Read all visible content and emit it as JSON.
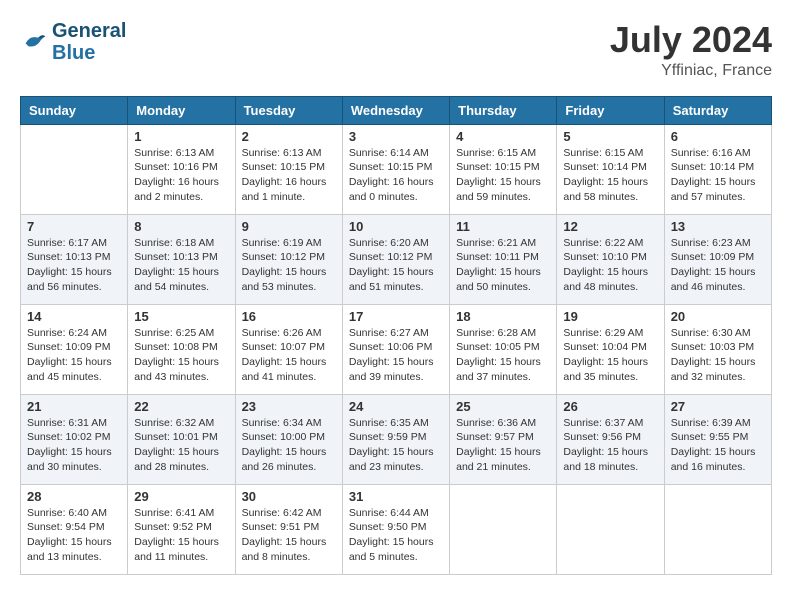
{
  "header": {
    "logo_line1": "General",
    "logo_line2": "Blue",
    "month_year": "July 2024",
    "location": "Yffiniac, France"
  },
  "days_of_week": [
    "Sunday",
    "Monday",
    "Tuesday",
    "Wednesday",
    "Thursday",
    "Friday",
    "Saturday"
  ],
  "weeks": [
    [
      {
        "day": "",
        "sunrise": "",
        "sunset": "",
        "daylight": ""
      },
      {
        "day": "1",
        "sunrise": "Sunrise: 6:13 AM",
        "sunset": "Sunset: 10:16 PM",
        "daylight": "Daylight: 16 hours and 2 minutes."
      },
      {
        "day": "2",
        "sunrise": "Sunrise: 6:13 AM",
        "sunset": "Sunset: 10:15 PM",
        "daylight": "Daylight: 16 hours and 1 minute."
      },
      {
        "day": "3",
        "sunrise": "Sunrise: 6:14 AM",
        "sunset": "Sunset: 10:15 PM",
        "daylight": "Daylight: 16 hours and 0 minutes."
      },
      {
        "day": "4",
        "sunrise": "Sunrise: 6:15 AM",
        "sunset": "Sunset: 10:15 PM",
        "daylight": "Daylight: 15 hours and 59 minutes."
      },
      {
        "day": "5",
        "sunrise": "Sunrise: 6:15 AM",
        "sunset": "Sunset: 10:14 PM",
        "daylight": "Daylight: 15 hours and 58 minutes."
      },
      {
        "day": "6",
        "sunrise": "Sunrise: 6:16 AM",
        "sunset": "Sunset: 10:14 PM",
        "daylight": "Daylight: 15 hours and 57 minutes."
      }
    ],
    [
      {
        "day": "7",
        "sunrise": "Sunrise: 6:17 AM",
        "sunset": "Sunset: 10:13 PM",
        "daylight": "Daylight: 15 hours and 56 minutes."
      },
      {
        "day": "8",
        "sunrise": "Sunrise: 6:18 AM",
        "sunset": "Sunset: 10:13 PM",
        "daylight": "Daylight: 15 hours and 54 minutes."
      },
      {
        "day": "9",
        "sunrise": "Sunrise: 6:19 AM",
        "sunset": "Sunset: 10:12 PM",
        "daylight": "Daylight: 15 hours and 53 minutes."
      },
      {
        "day": "10",
        "sunrise": "Sunrise: 6:20 AM",
        "sunset": "Sunset: 10:12 PM",
        "daylight": "Daylight: 15 hours and 51 minutes."
      },
      {
        "day": "11",
        "sunrise": "Sunrise: 6:21 AM",
        "sunset": "Sunset: 10:11 PM",
        "daylight": "Daylight: 15 hours and 50 minutes."
      },
      {
        "day": "12",
        "sunrise": "Sunrise: 6:22 AM",
        "sunset": "Sunset: 10:10 PM",
        "daylight": "Daylight: 15 hours and 48 minutes."
      },
      {
        "day": "13",
        "sunrise": "Sunrise: 6:23 AM",
        "sunset": "Sunset: 10:09 PM",
        "daylight": "Daylight: 15 hours and 46 minutes."
      }
    ],
    [
      {
        "day": "14",
        "sunrise": "Sunrise: 6:24 AM",
        "sunset": "Sunset: 10:09 PM",
        "daylight": "Daylight: 15 hours and 45 minutes."
      },
      {
        "day": "15",
        "sunrise": "Sunrise: 6:25 AM",
        "sunset": "Sunset: 10:08 PM",
        "daylight": "Daylight: 15 hours and 43 minutes."
      },
      {
        "day": "16",
        "sunrise": "Sunrise: 6:26 AM",
        "sunset": "Sunset: 10:07 PM",
        "daylight": "Daylight: 15 hours and 41 minutes."
      },
      {
        "day": "17",
        "sunrise": "Sunrise: 6:27 AM",
        "sunset": "Sunset: 10:06 PM",
        "daylight": "Daylight: 15 hours and 39 minutes."
      },
      {
        "day": "18",
        "sunrise": "Sunrise: 6:28 AM",
        "sunset": "Sunset: 10:05 PM",
        "daylight": "Daylight: 15 hours and 37 minutes."
      },
      {
        "day": "19",
        "sunrise": "Sunrise: 6:29 AM",
        "sunset": "Sunset: 10:04 PM",
        "daylight": "Daylight: 15 hours and 35 minutes."
      },
      {
        "day": "20",
        "sunrise": "Sunrise: 6:30 AM",
        "sunset": "Sunset: 10:03 PM",
        "daylight": "Daylight: 15 hours and 32 minutes."
      }
    ],
    [
      {
        "day": "21",
        "sunrise": "Sunrise: 6:31 AM",
        "sunset": "Sunset: 10:02 PM",
        "daylight": "Daylight: 15 hours and 30 minutes."
      },
      {
        "day": "22",
        "sunrise": "Sunrise: 6:32 AM",
        "sunset": "Sunset: 10:01 PM",
        "daylight": "Daylight: 15 hours and 28 minutes."
      },
      {
        "day": "23",
        "sunrise": "Sunrise: 6:34 AM",
        "sunset": "Sunset: 10:00 PM",
        "daylight": "Daylight: 15 hours and 26 minutes."
      },
      {
        "day": "24",
        "sunrise": "Sunrise: 6:35 AM",
        "sunset": "Sunset: 9:59 PM",
        "daylight": "Daylight: 15 hours and 23 minutes."
      },
      {
        "day": "25",
        "sunrise": "Sunrise: 6:36 AM",
        "sunset": "Sunset: 9:57 PM",
        "daylight": "Daylight: 15 hours and 21 minutes."
      },
      {
        "day": "26",
        "sunrise": "Sunrise: 6:37 AM",
        "sunset": "Sunset: 9:56 PM",
        "daylight": "Daylight: 15 hours and 18 minutes."
      },
      {
        "day": "27",
        "sunrise": "Sunrise: 6:39 AM",
        "sunset": "Sunset: 9:55 PM",
        "daylight": "Daylight: 15 hours and 16 minutes."
      }
    ],
    [
      {
        "day": "28",
        "sunrise": "Sunrise: 6:40 AM",
        "sunset": "Sunset: 9:54 PM",
        "daylight": "Daylight: 15 hours and 13 minutes."
      },
      {
        "day": "29",
        "sunrise": "Sunrise: 6:41 AM",
        "sunset": "Sunset: 9:52 PM",
        "daylight": "Daylight: 15 hours and 11 minutes."
      },
      {
        "day": "30",
        "sunrise": "Sunrise: 6:42 AM",
        "sunset": "Sunset: 9:51 PM",
        "daylight": "Daylight: 15 hours and 8 minutes."
      },
      {
        "day": "31",
        "sunrise": "Sunrise: 6:44 AM",
        "sunset": "Sunset: 9:50 PM",
        "daylight": "Daylight: 15 hours and 5 minutes."
      },
      {
        "day": "",
        "sunrise": "",
        "sunset": "",
        "daylight": ""
      },
      {
        "day": "",
        "sunrise": "",
        "sunset": "",
        "daylight": ""
      },
      {
        "day": "",
        "sunrise": "",
        "sunset": "",
        "daylight": ""
      }
    ]
  ]
}
